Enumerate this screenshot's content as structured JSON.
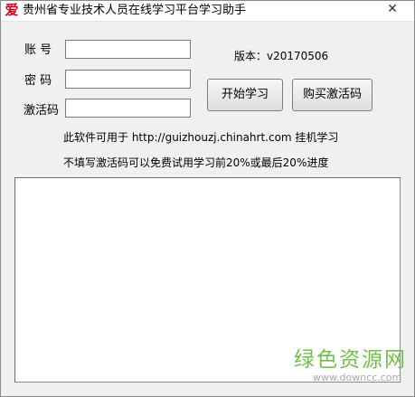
{
  "window": {
    "title": "贵州省专业技术人员在线学习平台学习助手",
    "icon_glyph": "爱",
    "icon_name": "app-logo-icon",
    "close_glyph": "✕"
  },
  "form": {
    "account_label": "账  号",
    "password_label": "密  码",
    "activation_label": "激活码",
    "account_value": "",
    "password_value": "",
    "activation_value": ""
  },
  "version_text": "版本：v20170506",
  "buttons": {
    "start": "开始学习",
    "buy": "购买激活码"
  },
  "info": {
    "line1": "此软件可用于 http://guizhouzj.chinahrt.com 挂机学习",
    "line2": "不填写激活码可以免费试用学习前20%或最后20%进度"
  },
  "log_text": "",
  "watermark": {
    "main": "绿色资源网",
    "url": "www.downcc.com"
  },
  "colors": {
    "icon_red": "#d0021b",
    "watermark_green": "#6fbf4a"
  }
}
